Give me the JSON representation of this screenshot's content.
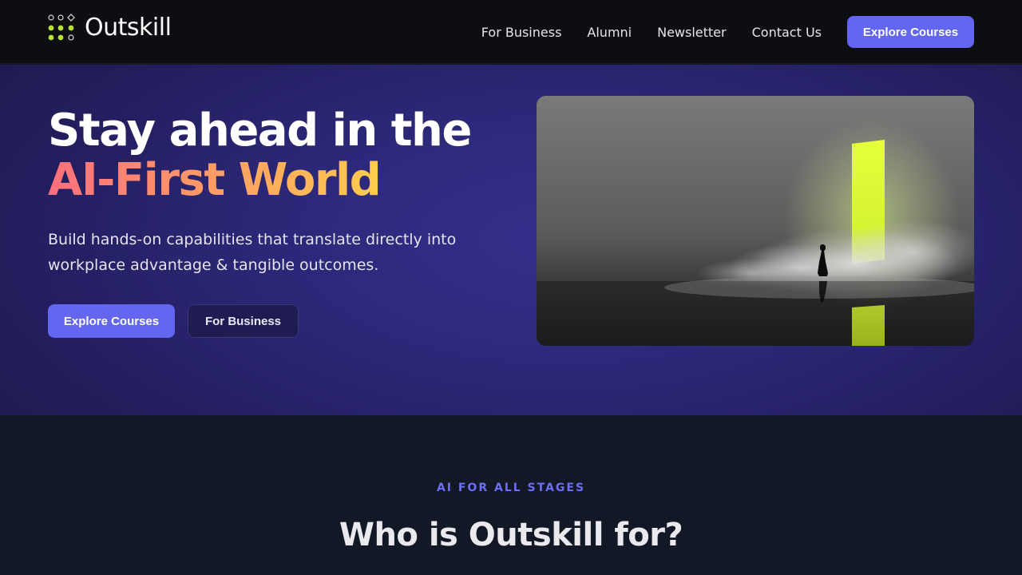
{
  "brand": {
    "name": "Outskill"
  },
  "nav": {
    "links": [
      "For Business",
      "Alumni",
      "Newsletter",
      "Contact Us"
    ],
    "cta_label": "Explore Courses"
  },
  "hero": {
    "title_line1": "Stay ahead in the",
    "title_line2": "AI-First World",
    "subtitle": "Build hands-on capabilities that translate directly into workplace advantage & tangible outcomes.",
    "primary_button": "Explore Courses",
    "secondary_button": "For Business"
  },
  "section": {
    "eyebrow": "AI FOR ALL STAGES",
    "title": "Who is Outskill for?"
  },
  "colors": {
    "accent": "#6366f1",
    "logo_green": "#b8e03a",
    "gradient_start": "#ff6f7d",
    "gradient_end": "#ffcc4d"
  }
}
